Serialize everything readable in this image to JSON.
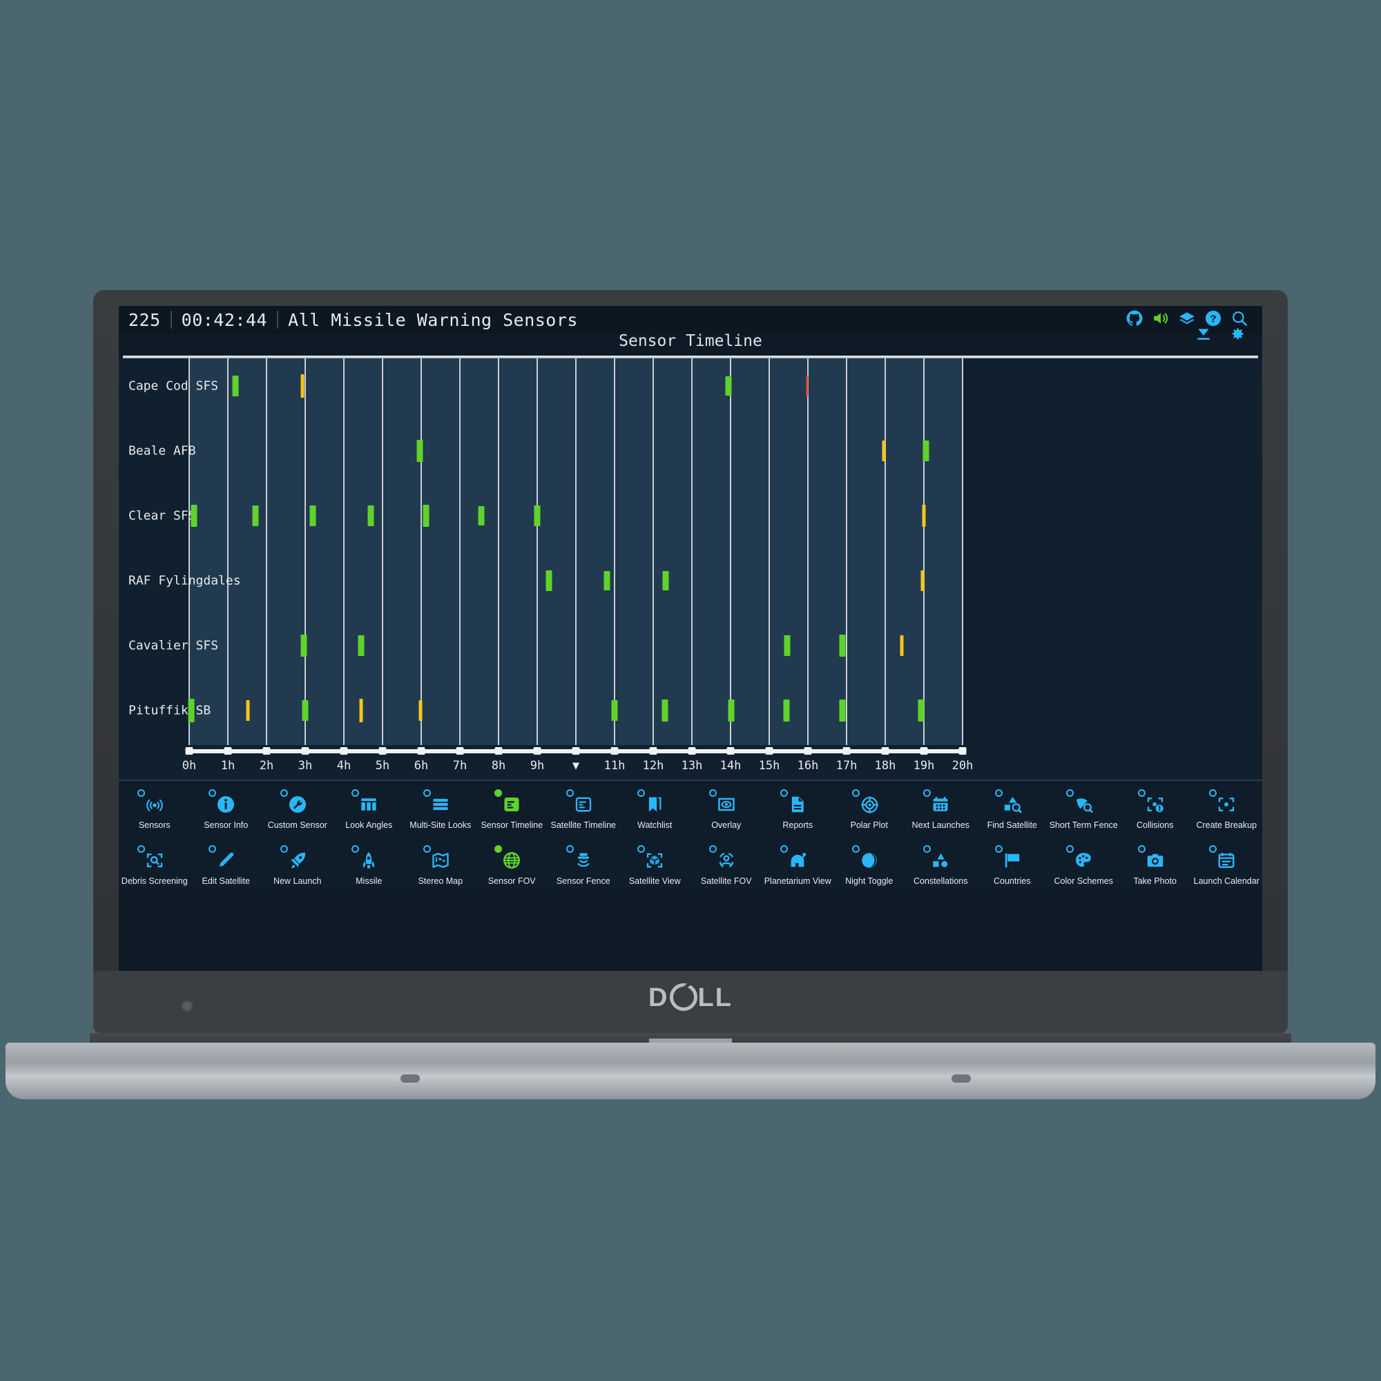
{
  "device": {
    "brand": "D⌀LL"
  },
  "header": {
    "day_of_year": "225",
    "clock": "00:42:44",
    "selection": "All Missile Warning Sensors",
    "icons": [
      {
        "name": "github-icon",
        "label": "GitHub",
        "color": "#29b6f6"
      },
      {
        "name": "sound-on-icon",
        "label": "Sound",
        "color": "#5fd32a"
      },
      {
        "name": "layers-icon",
        "label": "Layers",
        "color": "#29b6f6"
      },
      {
        "name": "help-icon",
        "label": "Help",
        "color": "#29b6f6"
      },
      {
        "name": "search-icon",
        "label": "Search",
        "color": "#29b6f6"
      },
      {
        "name": "download-icon",
        "label": "Download",
        "color": "#29b6f6"
      },
      {
        "name": "settings-gear-icon",
        "label": "Settings",
        "color": "#29b6f6"
      }
    ]
  },
  "chart_data": {
    "type": "timeline",
    "title": "Sensor Timeline",
    "xlabel": "",
    "ylabel": "",
    "xlim": [
      0,
      20
    ],
    "grid": true,
    "legend": "none",
    "x_ticks": [
      "0h",
      "1h",
      "2h",
      "3h",
      "4h",
      "5h",
      "6h",
      "7h",
      "8h",
      "9h",
      "▼",
      "11h",
      "12h",
      "13h",
      "14h",
      "15h",
      "16h",
      "17h",
      "18h",
      "19h",
      "20h"
    ],
    "current_time_marker_hour": 10,
    "colors": {
      "pass_good": "#5fd32a",
      "pass_warn": "#f5c518",
      "pass_alert": "#d94f3d",
      "band": "#223a4f",
      "grid": "#c8ced4"
    },
    "categories": [
      "Cape Cod SFS",
      "Beale AFB",
      "Clear SFS",
      "RAF Fylingdales",
      "Cavalier SFS",
      "Pituffik SB"
    ],
    "series": [
      {
        "name": "Cape Cod SFS",
        "events": [
          {
            "hour": 1.2,
            "color": "#5fd32a",
            "height": 30
          },
          {
            "hour": 2.93,
            "color": "#f5c518",
            "height": 34
          },
          {
            "hour": 13.94,
            "color": "#5fd32a",
            "height": 28
          },
          {
            "hour": 15.99,
            "color": "#d94f3d",
            "height": 30
          }
        ]
      },
      {
        "name": "Beale AFB",
        "events": [
          {
            "hour": 5.96,
            "color": "#5fd32a",
            "height": 32
          },
          {
            "hour": 17.96,
            "color": "#f5c518",
            "height": 30
          },
          {
            "hour": 19.05,
            "color": "#5fd32a",
            "height": 30
          }
        ]
      },
      {
        "name": "Clear SFS",
        "events": [
          {
            "hour": 0.13,
            "color": "#5fd32a",
            "height": 32
          },
          {
            "hour": 1.71,
            "color": "#5fd32a",
            "height": 30
          },
          {
            "hour": 3.2,
            "color": "#5fd32a",
            "height": 30
          },
          {
            "hour": 4.7,
            "color": "#5fd32a",
            "height": 30
          },
          {
            "hour": 6.12,
            "color": "#5fd32a",
            "height": 32
          },
          {
            "hour": 7.55,
            "color": "#5fd32a",
            "height": 28
          },
          {
            "hour": 9.0,
            "color": "#5fd32a",
            "height": 30
          },
          {
            "hour": 19.0,
            "color": "#f5c518",
            "height": 32
          }
        ]
      },
      {
        "name": "RAF Fylingdales",
        "events": [
          {
            "hour": 9.3,
            "color": "#5fd32a",
            "height": 30
          },
          {
            "hour": 10.8,
            "color": "#5fd32a",
            "height": 28
          },
          {
            "hour": 12.32,
            "color": "#5fd32a",
            "height": 28
          },
          {
            "hour": 18.96,
            "color": "#f5c518",
            "height": 30
          }
        ]
      },
      {
        "name": "Cavalier SFS",
        "events": [
          {
            "hour": 2.96,
            "color": "#5fd32a",
            "height": 32
          },
          {
            "hour": 4.44,
            "color": "#5fd32a",
            "height": 30
          },
          {
            "hour": 15.46,
            "color": "#5fd32a",
            "height": 30
          },
          {
            "hour": 16.9,
            "color": "#5fd32a",
            "height": 32
          },
          {
            "hour": 18.43,
            "color": "#f5c518",
            "height": 30
          }
        ]
      },
      {
        "name": "Pituffik SB",
        "events": [
          {
            "hour": 0.06,
            "color": "#5fd32a",
            "height": 34
          },
          {
            "hour": 1.52,
            "color": "#f5c518",
            "height": 30
          },
          {
            "hour": 3.0,
            "color": "#5fd32a",
            "height": 30
          },
          {
            "hour": 4.45,
            "color": "#f5c518",
            "height": 34
          },
          {
            "hour": 5.98,
            "color": "#f5c518",
            "height": 30
          },
          {
            "hour": 11.0,
            "color": "#5fd32a",
            "height": 30
          },
          {
            "hour": 12.3,
            "color": "#5fd32a",
            "height": 32
          },
          {
            "hour": 14.02,
            "color": "#5fd32a",
            "height": 32
          },
          {
            "hour": 15.44,
            "color": "#5fd32a",
            "height": 32
          },
          {
            "hour": 16.9,
            "color": "#5fd32a",
            "height": 32
          },
          {
            "hour": 18.93,
            "color": "#5fd32a",
            "height": 32
          }
        ]
      }
    ]
  },
  "toolbar": {
    "row1": [
      {
        "label": "Sensors",
        "icon": "sensors-icon",
        "active": false
      },
      {
        "label": "Sensor Info",
        "icon": "info-circle-icon",
        "active": false
      },
      {
        "label": "Custom Sensor",
        "icon": "wrench-circle-icon",
        "active": false
      },
      {
        "label": "Look Angles",
        "icon": "table-columns-icon",
        "active": false
      },
      {
        "label": "Multi-Site Looks",
        "icon": "stacked-bars-icon",
        "active": false
      },
      {
        "label": "Sensor Timeline",
        "icon": "timeline-doc-icon",
        "active": true
      },
      {
        "label": "Satellite Timeline",
        "icon": "timeline-outline-icon",
        "active": false
      },
      {
        "label": "Watchlist",
        "icon": "bookmark-icon",
        "active": false
      },
      {
        "label": "Overlay",
        "icon": "eye-frame-icon",
        "active": false
      },
      {
        "label": "Reports",
        "icon": "document-icon",
        "active": false
      },
      {
        "label": "Polar Plot",
        "icon": "crosshair-target-icon",
        "active": false
      },
      {
        "label": "Next Launches",
        "icon": "calendar-dots-icon",
        "active": false
      },
      {
        "label": "Find Satellite",
        "icon": "shapes-search-icon",
        "active": false
      },
      {
        "label": "Short Term Fence",
        "icon": "fence-search-icon",
        "active": false
      },
      {
        "label": "Collisions",
        "icon": "collision-alert-icon",
        "active": false
      },
      {
        "label": "Create Breakup",
        "icon": "breakup-target-icon",
        "active": false
      }
    ],
    "row2": [
      {
        "label": "Debris Screening",
        "icon": "debris-scan-icon",
        "active": false
      },
      {
        "label": "Edit Satellite",
        "icon": "pencil-icon",
        "active": false
      },
      {
        "label": "New Launch",
        "icon": "rocket-launch-icon",
        "active": false
      },
      {
        "label": "Missile",
        "icon": "missile-icon",
        "active": false
      },
      {
        "label": "Stereo Map",
        "icon": "map-icon",
        "active": false
      },
      {
        "label": "Sensor FOV",
        "icon": "globe-icon",
        "active": true
      },
      {
        "label": "Sensor Fence",
        "icon": "sensor-fence-icon",
        "active": false
      },
      {
        "label": "Satellite View",
        "icon": "cube-frame-icon",
        "active": false
      },
      {
        "label": "Satellite FOV",
        "icon": "satellite-fov-icon",
        "active": false
      },
      {
        "label": "Planetarium View",
        "icon": "observatory-icon",
        "active": false
      },
      {
        "label": "Night Toggle",
        "icon": "moon-icon",
        "active": false
      },
      {
        "label": "Constellations",
        "icon": "shapes-icon",
        "active": false
      },
      {
        "label": "Countries",
        "icon": "flag-icon",
        "active": false
      },
      {
        "label": "Color Schemes",
        "icon": "palette-icon",
        "active": false
      },
      {
        "label": "Take Photo",
        "icon": "camera-icon",
        "active": false
      },
      {
        "label": "Launch Calendar",
        "icon": "calendar-lines-icon",
        "active": false
      }
    ]
  }
}
